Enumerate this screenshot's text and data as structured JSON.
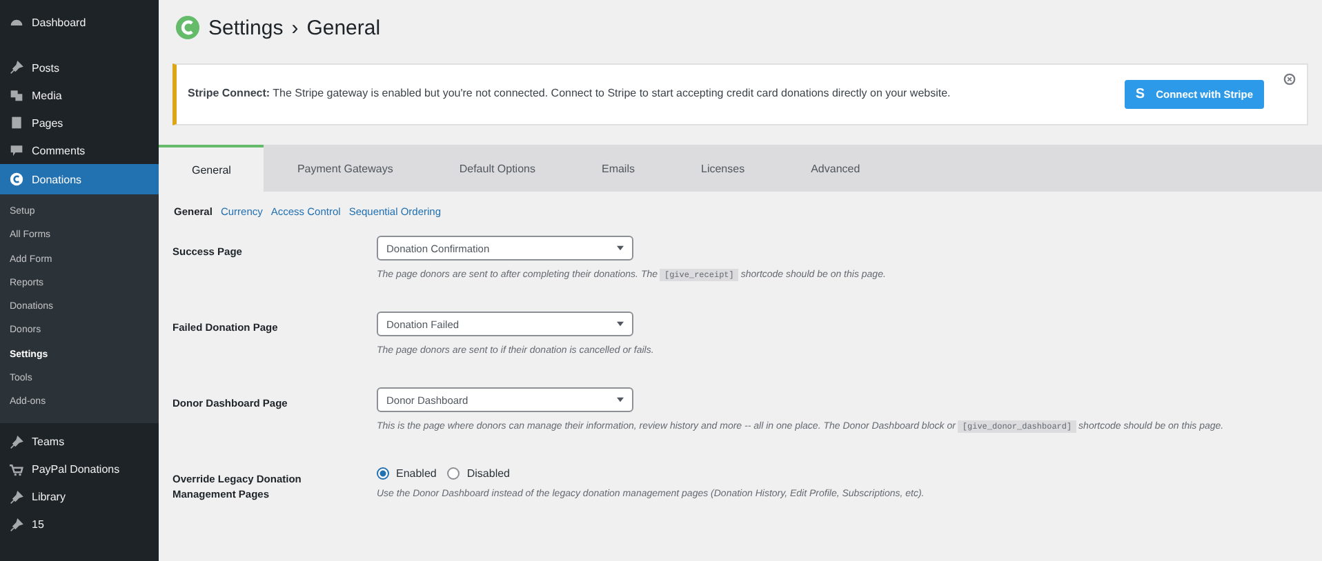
{
  "sidebar": {
    "items": [
      {
        "label": "Dashboard",
        "kind": "gauge",
        "selected": false
      },
      {
        "label": "Posts",
        "kind": "pin",
        "selected": false
      },
      {
        "label": "Media",
        "kind": "media",
        "selected": false
      },
      {
        "label": "Pages",
        "kind": "pages",
        "selected": false
      },
      {
        "label": "Comments",
        "kind": "comment",
        "selected": false
      },
      {
        "label": "Donations",
        "kind": "logo",
        "selected": true,
        "children": [
          {
            "label": "Setup",
            "selected": false
          },
          {
            "label": "All Forms",
            "selected": false
          },
          {
            "label": "Add Form",
            "selected": false
          },
          {
            "label": "Reports",
            "selected": false
          },
          {
            "label": "Donations",
            "selected": false
          },
          {
            "label": "Donors",
            "selected": false
          },
          {
            "label": "Settings",
            "selected": true
          },
          {
            "label": "Tools",
            "selected": false
          },
          {
            "label": "Add-ons",
            "selected": false
          }
        ]
      },
      {
        "label": "Teams",
        "kind": "pin",
        "selected": false
      },
      {
        "label": "PayPal Donations",
        "kind": "cart",
        "selected": false
      },
      {
        "label": "Library",
        "kind": "pin",
        "selected": false
      },
      {
        "label": "15",
        "kind": "pin",
        "selected": false
      }
    ]
  },
  "header": {
    "title": "Settings",
    "separator": "›",
    "subtitle": "General"
  },
  "notice": {
    "text": "**Stripe Connect:** The Stripe gateway is enabled but you're not connected. Connect to Stripe to start accepting credit card donations directly on your website.",
    "button_icon": "S",
    "button": "Connect with Stripe"
  },
  "tabs": [
    {
      "label": "General",
      "selected": true
    },
    {
      "label": "Payment Gateways",
      "selected": false
    },
    {
      "label": "Default Options",
      "selected": false
    },
    {
      "label": "Emails",
      "selected": false
    },
    {
      "label": "Licenses",
      "selected": false
    },
    {
      "label": "Advanced",
      "selected": false
    }
  ],
  "subtabs": [
    {
      "label": "General",
      "selected": true
    },
    {
      "label": "Currency",
      "selected": false
    },
    {
      "label": "Access Control",
      "selected": false
    },
    {
      "label": "Sequential Ordering",
      "selected": false
    }
  ],
  "fields": [
    {
      "kind": "select",
      "label": "Success Page",
      "value": "Donation Confirmation",
      "description": [
        {
          "kind": "text",
          "text": "The page donors are sent to after completing their donations. The "
        },
        {
          "kind": "code",
          "text": "[give_receipt]"
        },
        {
          "kind": "text",
          "text": " shortcode should be on this page."
        }
      ]
    },
    {
      "kind": "select",
      "label": "Failed Donation Page",
      "value": "Donation Failed",
      "description": [
        {
          "kind": "text",
          "text": "The page donors are sent to if their donation is cancelled or fails."
        }
      ]
    },
    {
      "kind": "select",
      "label": "Donor Dashboard Page",
      "value": "Donor Dashboard",
      "description": [
        {
          "kind": "text",
          "text": "This is the page where donors can manage their information, review history and more -- all in one place. The Donor Dashboard block or "
        },
        {
          "kind": "code",
          "text": "[give_donor_dashboard]"
        },
        {
          "kind": "text",
          "text": " shortcode should be on this page."
        }
      ]
    },
    {
      "kind": "radio",
      "label": "Override Legacy Donation Management Pages",
      "options": [
        {
          "label": "Enabled",
          "selected": true
        },
        {
          "label": "Disabled",
          "selected": false
        }
      ],
      "description": [
        {
          "kind": "text",
          "text": "Use the Donor Dashboard instead of the legacy donation management pages (Donation History, Edit Profile, Subscriptions, etc)."
        }
      ]
    }
  ]
}
